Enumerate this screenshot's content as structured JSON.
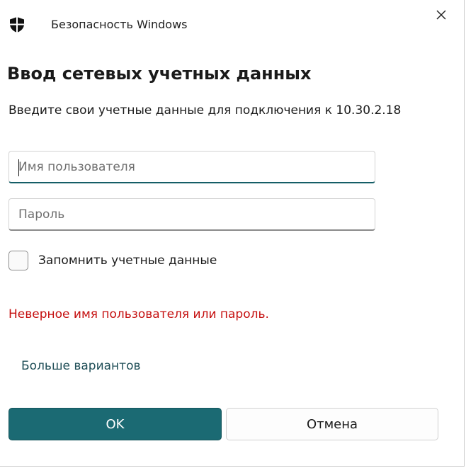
{
  "window": {
    "app_title": "Безопасность Windows",
    "shield_icon": "shield-icon",
    "close_icon": "close-icon"
  },
  "dialog": {
    "heading": "Ввод сетевых учетных данных",
    "subtitle": "Введите свои учетные данные для подключения к 10.30.2.18"
  },
  "form": {
    "username": {
      "value": "",
      "placeholder": "Имя пользователя"
    },
    "password": {
      "value": "",
      "placeholder": "Пароль"
    },
    "remember": {
      "label": "Запомнить учетные данные",
      "checked": false
    }
  },
  "error_message": "Неверное имя пользователя или пароль.",
  "more_options_label": "Больше вариантов",
  "buttons": {
    "ok_label": "OK",
    "cancel_label": "Отмена"
  },
  "colors": {
    "accent": "#1b6a73",
    "error": "#c50f0f",
    "link": "#1f4e57"
  }
}
